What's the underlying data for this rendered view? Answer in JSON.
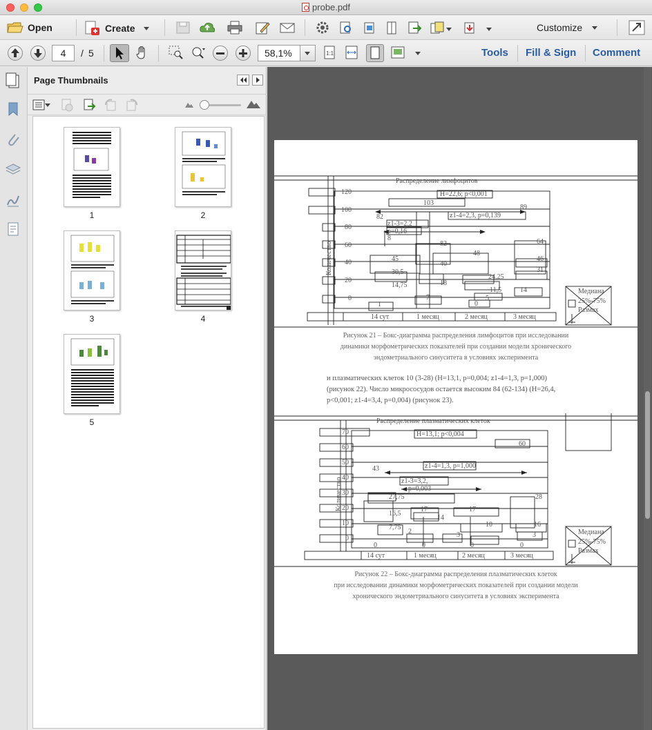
{
  "window": {
    "title": "probe.pdf"
  },
  "toolbar1": {
    "open_label": "Open",
    "create_label": "Create",
    "customize_label": "Customize"
  },
  "toolbar2": {
    "current_page": "4",
    "page_separator": "/",
    "total_pages": "5",
    "zoom": "58,1%",
    "tools_label": "Tools",
    "fill_sign_label": "Fill & Sign",
    "comment_label": "Comment"
  },
  "thumbnails_panel": {
    "title": "Page Thumbnails",
    "pages": [
      {
        "label": "1"
      },
      {
        "label": "2"
      },
      {
        "label": "3"
      },
      {
        "label": "4"
      },
      {
        "label": "5"
      }
    ]
  },
  "document": {
    "figure1": {
      "chart_title": "Распределение лимфоцитов",
      "stat_main": "H=22,6; p<0,001",
      "stat_cmp1": "z1-4=2,3, p=0,139",
      "stat_cmp2": "z1-3=2,2",
      "stat_cmp2b": "p=0,16",
      "stat_cmp2c": "8",
      "y_axis_label": "Количество",
      "y_ticks": [
        "120",
        "100",
        "80",
        "60",
        "40",
        "20",
        "0"
      ],
      "x_categories": [
        "14 сут",
        "1 месяц",
        "2 месяц",
        "3 месяц"
      ],
      "values": [
        "103",
        "89",
        "82",
        "82",
        "64",
        "48",
        "45",
        "46",
        "30,5",
        "40",
        "14,75",
        "18",
        "24,25",
        "11,5",
        "31",
        "14",
        "1",
        "7",
        "0",
        "5"
      ],
      "legend": {
        "median": "Медиана",
        "iqr": "25%-75%",
        "range": "Размах"
      },
      "caption_line1": "Рисунок 21 – Бокс-диаграмма распределения лимфоцитов при исследовании",
      "caption_line2": "динамики морфометрических показателей при создании модели хронического",
      "caption_line3": "эндометриального синуситета в условиях эксперимента"
    },
    "paragraph_line1": "и плазматических клеток 10 (3-28) (H=13,1, p=0,004; z1-4=1,3, p=1,000)",
    "paragraph_line2": "(рисунок 22). Число микрососудов остается высоким 84 (62-134) (H=26,4,",
    "paragraph_line3": "p<0,001; z1-4=3,4, p=0,004) (рисунок 23).",
    "figure2": {
      "chart_title": "Распределение плазматических клеток",
      "stat_main": "H=13,1; p<0,004",
      "stat_cmp1": "z1-4=1,3, p=1,000",
      "stat_cmp2": "z1-3=3,2,",
      "stat_cmp2b": "p=0,003",
      "y_axis_label": "Количество",
      "y_ticks": [
        "70",
        "60",
        "50",
        "40",
        "30",
        "20",
        "10",
        "0"
      ],
      "x_categories": [
        "14 сут",
        "1 месяц",
        "2 месяц",
        "3 месяц"
      ],
      "values": [
        "60",
        "43",
        "27,75",
        "28",
        "16,5",
        "17",
        "14",
        "17",
        "7,75",
        "10",
        "16",
        "2",
        "3",
        "3",
        "0",
        "0",
        "0",
        "0"
      ],
      "legend": {
        "median": "Медиана",
        "iqr": "25%-75%",
        "range": "Размах"
      },
      "caption_line1": "Рисунок 22 – Бокс-диаграмма распределения плазматических клеток",
      "caption_line2": "при исследовании динамики морфометрических показателей при создании модели",
      "caption_line3": "хронического эндометриального синуситета в условиях эксперимента"
    }
  }
}
